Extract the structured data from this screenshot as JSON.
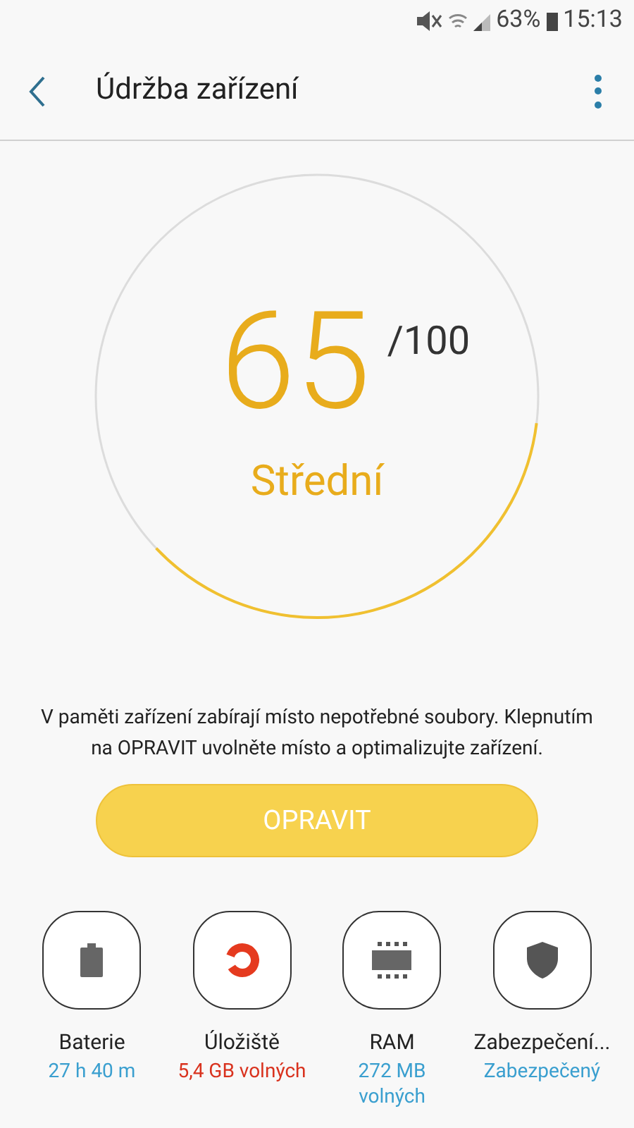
{
  "status_bar": {
    "battery": "63%",
    "time": "15:13"
  },
  "header": {
    "title": "Údržba zařízení"
  },
  "score": {
    "value": "65",
    "max": "/100",
    "rating": "Střední",
    "level": 0.36
  },
  "message": "V paměti zařízení zabírají místo nepotřebné soubory. Klepnutím na OPRAVIT uvolněte místo a optimalizujte zařízení.",
  "fix_button": "OPRAVIT",
  "categories": [
    {
      "kind": "battery",
      "label": "Baterie",
      "status": "27 h 40 m",
      "color": "#3a9fcf"
    },
    {
      "kind": "storage",
      "label": "Úložiště",
      "status": "5,4 GB volných",
      "color": "#d9321e"
    },
    {
      "kind": "ram",
      "label": "RAM",
      "status": "272 MB volných",
      "color": "#3a9fcf"
    },
    {
      "kind": "security",
      "label": "Zabezpečení...",
      "status": "Zabezpečený",
      "color": "#3a9fcf"
    }
  ]
}
